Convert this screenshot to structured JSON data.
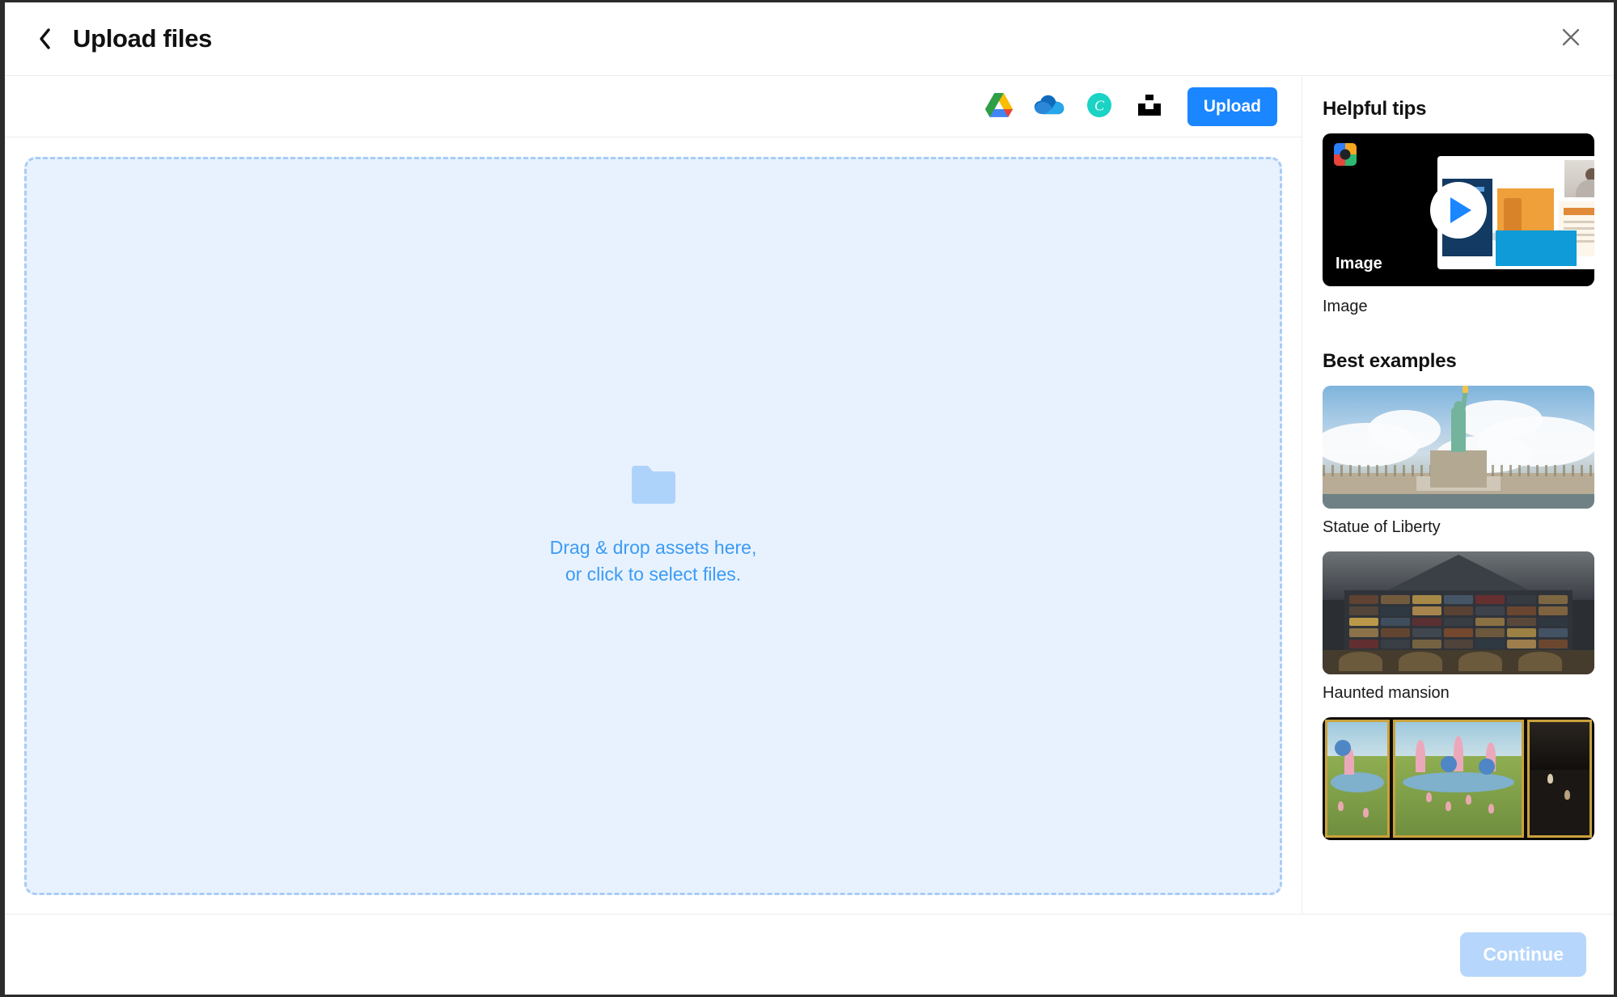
{
  "window": {
    "title": "Upload files",
    "back_icon": "chevron-left-icon",
    "close_icon": "close-icon"
  },
  "toolbar": {
    "sources": [
      {
        "name": "google-drive",
        "label": "Google Drive"
      },
      {
        "name": "onedrive",
        "label": "OneDrive"
      },
      {
        "name": "canva",
        "label": "Canva"
      },
      {
        "name": "unsplash",
        "label": "Unsplash"
      }
    ],
    "upload_label": "Upload"
  },
  "dropzone": {
    "icon": "folder-icon",
    "line1": "Drag & drop assets here,",
    "line2": "or click to select files.",
    "border_color": "#a8ccf7",
    "fill_color": "#e8f2fe",
    "text_color": "#3b9bf5"
  },
  "sidebar": {
    "tips_heading": "Helpful tips",
    "tip_video": {
      "badge_label": "Image",
      "caption": "Image",
      "play_icon": "play-icon"
    },
    "examples_heading": "Best examples",
    "examples": [
      {
        "caption": "Statue of Liberty"
      },
      {
        "caption": "Haunted mansion"
      },
      {
        "caption": ""
      }
    ]
  },
  "footer": {
    "continue_label": "Continue",
    "continue_disabled_color": "#b6d6fb"
  },
  "colors": {
    "accent": "#1a86ff",
    "border": "#ececec",
    "chrome": "#2b2b2b"
  }
}
